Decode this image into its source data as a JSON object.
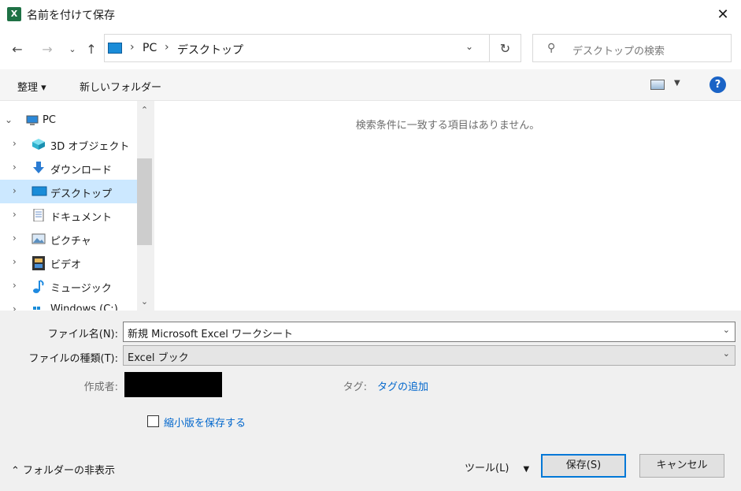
{
  "window": {
    "title": "名前を付けて保存",
    "app_icon": "excel-icon",
    "logo_letter": "X",
    "close_glyph": "✕"
  },
  "address": {
    "breadcrumbs": [
      "PC",
      "デスクトップ"
    ],
    "search_placeholder": "デスクトップの検索"
  },
  "toolbar": {
    "organize_label": "整理 ▾",
    "new_folder_label": "新しいフォルダー"
  },
  "nav": {
    "items": [
      {
        "label": "PC",
        "icon": "pc-icon",
        "expanded": true,
        "selected": false
      },
      {
        "label": "3D オブジェクト",
        "icon": "3d-objects-icon",
        "expanded": false,
        "selected": false
      },
      {
        "label": "ダウンロード",
        "icon": "download-icon",
        "expanded": false,
        "selected": false
      },
      {
        "label": "デスクトップ",
        "icon": "desktop-icon",
        "expanded": false,
        "selected": true
      },
      {
        "label": "ドキュメント",
        "icon": "documents-icon",
        "expanded": false,
        "selected": false
      },
      {
        "label": "ピクチャ",
        "icon": "pictures-icon",
        "expanded": false,
        "selected": false
      },
      {
        "label": "ビデオ",
        "icon": "videos-icon",
        "expanded": false,
        "selected": false
      },
      {
        "label": "ミュージック",
        "icon": "music-icon",
        "expanded": false,
        "selected": false
      },
      {
        "label": "Windows (C:)",
        "icon": "drive-icon",
        "expanded": false,
        "selected": false
      }
    ]
  },
  "content": {
    "empty_message": "検索条件に一致する項目はありません。"
  },
  "form": {
    "filename_label": "ファイル名(N):",
    "filename_value": "新規 Microsoft Excel ワークシート",
    "filetype_label": "ファイルの種類(T):",
    "filetype_value": "Excel ブック",
    "author_label": "作成者:",
    "tags_label": "タグ:",
    "tags_link": "タグの追加",
    "thumbnail_label": "縮小版を保存する",
    "thumbnail_checked": false
  },
  "footer": {
    "hide_folders_label": "フォルダーの非表示",
    "tools_label": "ツール(L)",
    "save_label": "保存(S)",
    "cancel_label": "キャンセル"
  },
  "colors": {
    "accent": "#0078d7",
    "selection": "#cce8ff",
    "link": "#0066cc",
    "excel_green": "#1e7145"
  }
}
